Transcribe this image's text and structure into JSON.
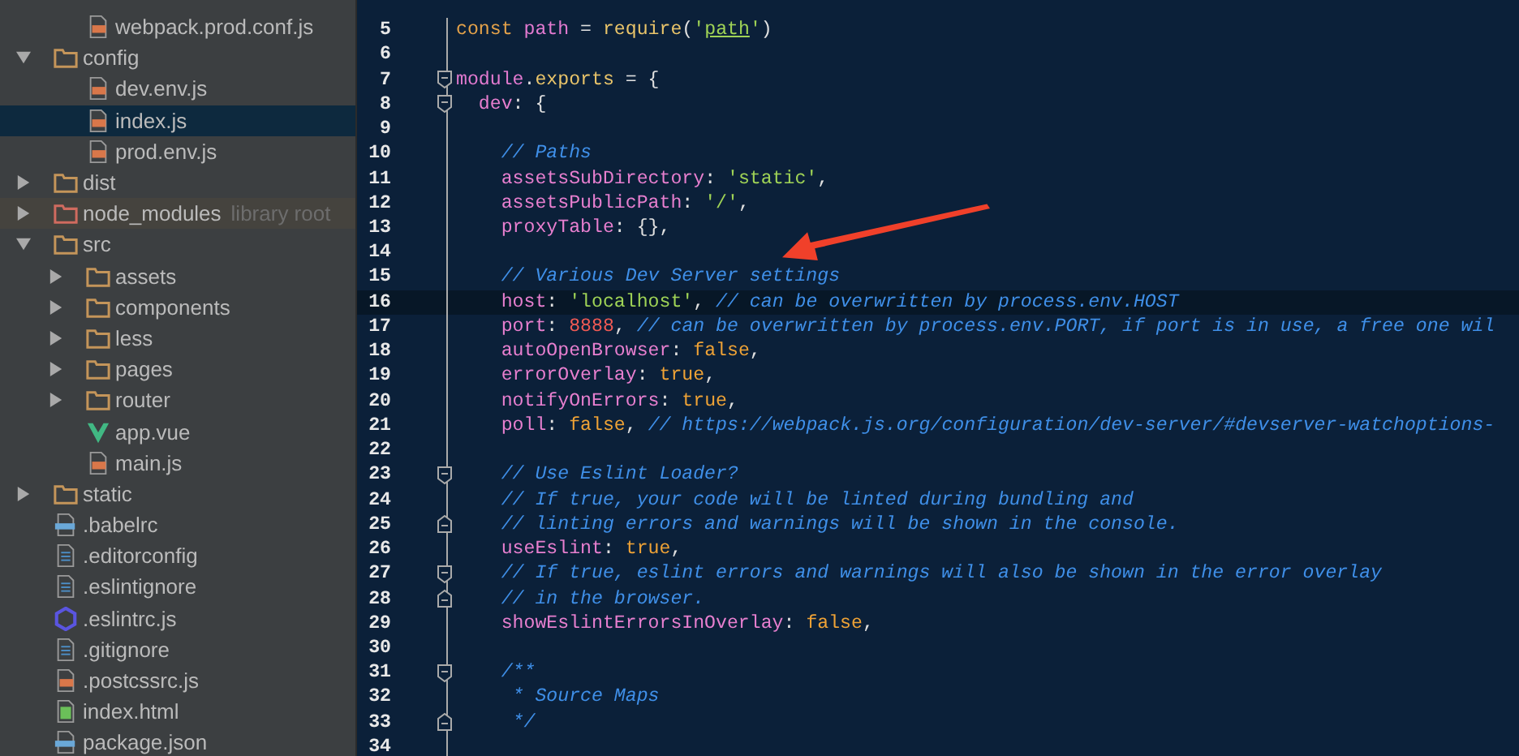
{
  "project_tree": {
    "orphan_rows": [
      {
        "name": "webpack.prod.conf.js",
        "kind": "js",
        "selected": false
      }
    ],
    "items": [
      {
        "name": "config",
        "kind": "folder",
        "expanded": true,
        "selected": false,
        "children": [
          {
            "name": "dev.env.js",
            "kind": "js",
            "selected": false
          },
          {
            "name": "index.js",
            "kind": "js",
            "selected": true
          },
          {
            "name": "prod.env.js",
            "kind": "js",
            "selected": false
          }
        ]
      },
      {
        "name": "dist",
        "kind": "folder",
        "expanded": false,
        "selected": false
      },
      {
        "name": "node_modules",
        "kind": "library",
        "hint": "library root",
        "expanded": false,
        "selected": false
      },
      {
        "name": "src",
        "kind": "folder",
        "expanded": true,
        "selected": false,
        "children": [
          {
            "name": "assets",
            "kind": "folder",
            "expanded": false,
            "selected": false
          },
          {
            "name": "components",
            "kind": "folder",
            "expanded": false,
            "selected": false
          },
          {
            "name": "less",
            "kind": "folder",
            "expanded": false,
            "selected": false
          },
          {
            "name": "pages",
            "kind": "folder",
            "expanded": false,
            "selected": false
          },
          {
            "name": "router",
            "kind": "folder",
            "expanded": false,
            "selected": false
          },
          {
            "name": "app.vue",
            "kind": "vue",
            "selected": false
          },
          {
            "name": "main.js",
            "kind": "js",
            "selected": false
          }
        ]
      },
      {
        "name": "static",
        "kind": "folder",
        "expanded": false,
        "selected": false
      },
      {
        "name": ".babelrc",
        "kind": "json",
        "selected": false
      },
      {
        "name": ".editorconfig",
        "kind": "text",
        "selected": false
      },
      {
        "name": ".eslintignore",
        "kind": "text",
        "selected": false
      },
      {
        "name": ".eslintrc.js",
        "kind": "eslint",
        "selected": false
      },
      {
        "name": ".gitignore",
        "kind": "text",
        "selected": false
      },
      {
        "name": ".postcssrc.js",
        "kind": "js",
        "selected": false
      },
      {
        "name": "index.html",
        "kind": "html",
        "selected": false
      },
      {
        "name": "package.json",
        "kind": "json",
        "selected": false
      }
    ]
  },
  "editor": {
    "lines": [
      {
        "number": "5",
        "current": false,
        "fold_start": false,
        "fold_end": false,
        "tokens": [
          {
            "kind": "kw",
            "text": "const "
          },
          {
            "kind": "var",
            "text": "path"
          },
          {
            "kind": "punct",
            "text": " = "
          },
          {
            "kind": "fn",
            "text": "require"
          },
          {
            "kind": "punct",
            "text": "("
          },
          {
            "kind": "str",
            "text": "'"
          },
          {
            "kind": "match",
            "text": "path"
          },
          {
            "kind": "str",
            "text": "'"
          },
          {
            "kind": "punct",
            "text": ")"
          }
        ]
      },
      {
        "number": "6",
        "current": false,
        "fold_start": false,
        "fold_end": false
      },
      {
        "number": "7",
        "current": false,
        "fold_start": true,
        "fold_end": false,
        "tokens": [
          {
            "kind": "var",
            "text": "module"
          },
          {
            "kind": "punct",
            "text": "."
          },
          {
            "kind": "fn",
            "text": "exports"
          },
          {
            "kind": "punct",
            "text": " = {"
          }
        ]
      },
      {
        "number": "8",
        "current": false,
        "fold_start": true,
        "fold_end": false,
        "tokens": [
          {
            "kind": "prop",
            "text": "  dev"
          },
          {
            "kind": "punct",
            "text": ": {"
          }
        ]
      },
      {
        "number": "9",
        "current": false,
        "fold_start": false,
        "fold_end": false
      },
      {
        "number": "10",
        "current": false,
        "fold_start": false,
        "fold_end": false,
        "tokens": [
          {
            "kind": "cmt",
            "text": "    // Paths"
          }
        ]
      },
      {
        "number": "11",
        "current": false,
        "fold_start": false,
        "fold_end": false,
        "tokens": [
          {
            "kind": "prop",
            "text": "    assetsSubDirectory"
          },
          {
            "kind": "punct",
            "text": ": "
          },
          {
            "kind": "str",
            "text": "'static'"
          },
          {
            "kind": "punct",
            "text": ","
          }
        ]
      },
      {
        "number": "12",
        "current": false,
        "fold_start": false,
        "fold_end": false,
        "tokens": [
          {
            "kind": "prop",
            "text": "    assetsPublicPath"
          },
          {
            "kind": "punct",
            "text": ": "
          },
          {
            "kind": "str",
            "text": "'/'"
          },
          {
            "kind": "punct",
            "text": ","
          }
        ]
      },
      {
        "number": "13",
        "current": false,
        "fold_start": false,
        "fold_end": false,
        "tokens": [
          {
            "kind": "prop",
            "text": "    proxyTable"
          },
          {
            "kind": "punct",
            "text": ": {},"
          }
        ]
      },
      {
        "number": "14",
        "current": false,
        "fold_start": false,
        "fold_end": false
      },
      {
        "number": "15",
        "current": false,
        "fold_start": false,
        "fold_end": false,
        "tokens": [
          {
            "kind": "cmt",
            "text": "    // Various Dev Server settings"
          }
        ]
      },
      {
        "number": "16",
        "current": true,
        "fold_start": false,
        "fold_end": false,
        "tokens": [
          {
            "kind": "prop",
            "text": "    host"
          },
          {
            "kind": "punct",
            "text": ": "
          },
          {
            "kind": "str",
            "text": "'localhost'"
          },
          {
            "kind": "punct",
            "text": ", "
          },
          {
            "kind": "cmt",
            "text": "// can be overwritten by process.env.HOST"
          }
        ]
      },
      {
        "number": "17",
        "current": false,
        "fold_start": false,
        "fold_end": false,
        "tokens": [
          {
            "kind": "prop",
            "text": "    port"
          },
          {
            "kind": "punct",
            "text": ": "
          },
          {
            "kind": "num",
            "text": "8888"
          },
          {
            "kind": "punct",
            "text": ", "
          },
          {
            "kind": "cmt",
            "text": "// can be overwritten by process.env.PORT, if port is in use, a free one wil"
          }
        ]
      },
      {
        "number": "18",
        "current": false,
        "fold_start": false,
        "fold_end": false,
        "tokens": [
          {
            "kind": "prop",
            "text": "    autoOpenBrowser"
          },
          {
            "kind": "punct",
            "text": ": "
          },
          {
            "kind": "bool",
            "text": "false"
          },
          {
            "kind": "punct",
            "text": ","
          }
        ]
      },
      {
        "number": "19",
        "current": false,
        "fold_start": false,
        "fold_end": false,
        "tokens": [
          {
            "kind": "prop",
            "text": "    errorOverlay"
          },
          {
            "kind": "punct",
            "text": ": "
          },
          {
            "kind": "bool",
            "text": "true"
          },
          {
            "kind": "punct",
            "text": ","
          }
        ]
      },
      {
        "number": "20",
        "current": false,
        "fold_start": false,
        "fold_end": false,
        "tokens": [
          {
            "kind": "prop",
            "text": "    notifyOnErrors"
          },
          {
            "kind": "punct",
            "text": ": "
          },
          {
            "kind": "bool",
            "text": "true"
          },
          {
            "kind": "punct",
            "text": ","
          }
        ]
      },
      {
        "number": "21",
        "current": false,
        "fold_start": false,
        "fold_end": false,
        "tokens": [
          {
            "kind": "prop",
            "text": "    poll"
          },
          {
            "kind": "punct",
            "text": ": "
          },
          {
            "kind": "bool",
            "text": "false"
          },
          {
            "kind": "punct",
            "text": ", "
          },
          {
            "kind": "cmt",
            "text": "// https://webpack.js.org/configuration/dev-server/#devserver-watchoptions-"
          }
        ]
      },
      {
        "number": "22",
        "current": false,
        "fold_start": false,
        "fold_end": false
      },
      {
        "number": "23",
        "current": false,
        "fold_start": true,
        "fold_end": false,
        "tokens": [
          {
            "kind": "cmt",
            "text": "    // Use Eslint Loader?"
          }
        ]
      },
      {
        "number": "24",
        "current": false,
        "fold_start": false,
        "fold_end": false,
        "tokens": [
          {
            "kind": "cmt",
            "text": "    // If true, your code will be linted during bundling and"
          }
        ]
      },
      {
        "number": "25",
        "current": false,
        "fold_start": false,
        "fold_end": true,
        "tokens": [
          {
            "kind": "cmt",
            "text": "    // linting errors and warnings will be shown in the console."
          }
        ]
      },
      {
        "number": "26",
        "current": false,
        "fold_start": false,
        "fold_end": false,
        "tokens": [
          {
            "kind": "prop",
            "text": "    useEslint"
          },
          {
            "kind": "punct",
            "text": ": "
          },
          {
            "kind": "bool",
            "text": "true"
          },
          {
            "kind": "punct",
            "text": ","
          }
        ]
      },
      {
        "number": "27",
        "current": false,
        "fold_start": true,
        "fold_end": false,
        "tokens": [
          {
            "kind": "cmt",
            "text": "    // If true, eslint errors and warnings will also be shown in the error overlay"
          }
        ]
      },
      {
        "number": "28",
        "current": false,
        "fold_start": false,
        "fold_end": true,
        "tokens": [
          {
            "kind": "cmt",
            "text": "    // in the browser."
          }
        ]
      },
      {
        "number": "29",
        "current": false,
        "fold_start": false,
        "fold_end": false,
        "tokens": [
          {
            "kind": "prop",
            "text": "    showEslintErrorsInOverlay"
          },
          {
            "kind": "punct",
            "text": ": "
          },
          {
            "kind": "bool",
            "text": "false"
          },
          {
            "kind": "punct",
            "text": ","
          }
        ]
      },
      {
        "number": "30",
        "current": false,
        "fold_start": false,
        "fold_end": false
      },
      {
        "number": "31",
        "current": false,
        "fold_start": true,
        "fold_end": false,
        "tokens": [
          {
            "kind": "cmt",
            "text": "    /**"
          }
        ]
      },
      {
        "number": "32",
        "current": false,
        "fold_start": false,
        "fold_end": false,
        "tokens": [
          {
            "kind": "cmt",
            "text": "     * Source Maps"
          }
        ]
      },
      {
        "number": "33",
        "current": false,
        "fold_start": false,
        "fold_end": true,
        "tokens": [
          {
            "kind": "cmt",
            "text": "     */"
          }
        ]
      },
      {
        "number": "34",
        "current": false,
        "fold_start": false,
        "fold_end": false
      }
    ]
  }
}
